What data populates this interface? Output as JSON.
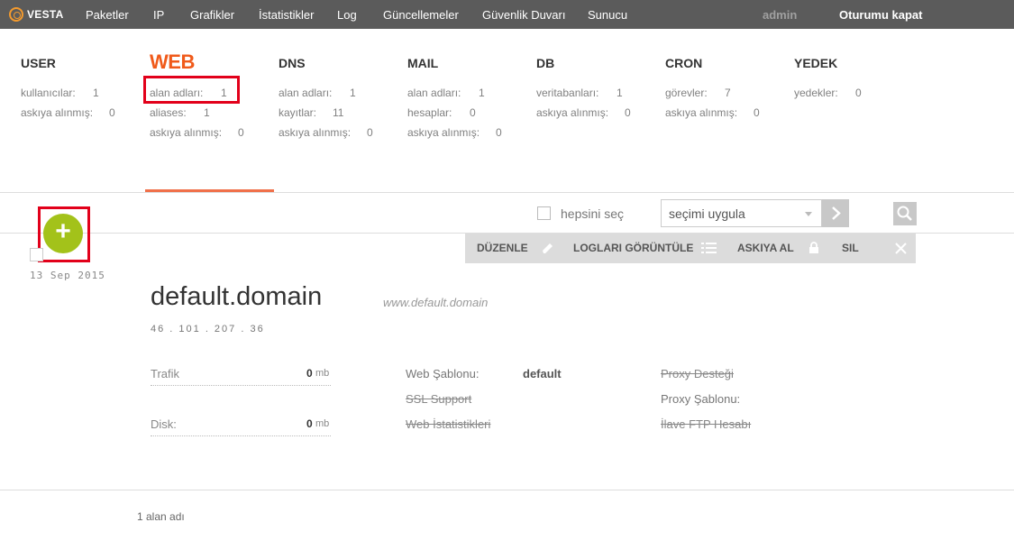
{
  "nav": {
    "logo": "VESTA",
    "items": [
      "Paketler",
      "IP",
      "Grafikler",
      "İstatistikler",
      "Log",
      "Güncellemeler",
      "Güvenlik Duvarı",
      "Sunucu"
    ],
    "user": "admin",
    "logout": "Oturumu kapat"
  },
  "stats": {
    "user": {
      "title": "USER",
      "rows": [
        {
          "label": "kullanıcılar:",
          "value": "1"
        },
        {
          "label": "askıya alınmış:",
          "value": "0"
        }
      ]
    },
    "web": {
      "title": "WEB",
      "rows": [
        {
          "label": "alan adları:",
          "value": "1"
        },
        {
          "label": "aliases:",
          "value": "1"
        },
        {
          "label": "askıya alınmış:",
          "value": "0"
        }
      ]
    },
    "dns": {
      "title": "DNS",
      "rows": [
        {
          "label": "alan adları:",
          "value": "1"
        },
        {
          "label": "kayıtlar:",
          "value": "11"
        },
        {
          "label": "askıya alınmış:",
          "value": "0"
        }
      ]
    },
    "mail": {
      "title": "MAIL",
      "rows": [
        {
          "label": "alan adları:",
          "value": "1"
        },
        {
          "label": "hesaplar:",
          "value": "0"
        },
        {
          "label": "askıya alınmış:",
          "value": "0"
        }
      ]
    },
    "db": {
      "title": "DB",
      "rows": [
        {
          "label": "veritabanları:",
          "value": "1"
        },
        {
          "label": "askıya alınmış:",
          "value": "0"
        }
      ]
    },
    "cron": {
      "title": "CRON",
      "rows": [
        {
          "label": "görevler:",
          "value": "7"
        },
        {
          "label": "askıya alınmış:",
          "value": "0"
        }
      ]
    },
    "backup": {
      "title": "YEDEK",
      "rows": [
        {
          "label": "yedekler:",
          "value": "0"
        }
      ]
    }
  },
  "toolbar": {
    "select_all": "hepsini seç",
    "bulk_action": "seçimi uygula"
  },
  "actions": {
    "edit": "DÜZENLE",
    "logs": "LOGLARI GÖRÜNTÜLE",
    "suspend": "ASKIYA AL",
    "delete": "SIL"
  },
  "item": {
    "date": "13 Sep 2015",
    "domain": "default.domain",
    "alias": "www.default.domain",
    "ip": "46 . 101 . 207 . 36",
    "traffic_label": "Trafik",
    "traffic_value": "0",
    "traffic_unit": "mb",
    "disk_label": "Disk:",
    "disk_value": "0",
    "disk_unit": "mb",
    "web_template_label": "Web Şablonu:",
    "web_template_value": "default",
    "ssl_support": "SSL Support",
    "web_stats": "Web İstatistikleri",
    "proxy_support": "Proxy Desteği",
    "proxy_template_label": "Proxy Şablonu:",
    "extra_ftp": "İlave FTP Hesabı"
  },
  "footer": {
    "count": "1 alan adı"
  },
  "colors": {
    "accent": "#f05a1a",
    "add": "#a3c21a",
    "nav_bg": "#5b5b5b",
    "highlight": "#e2001a"
  }
}
